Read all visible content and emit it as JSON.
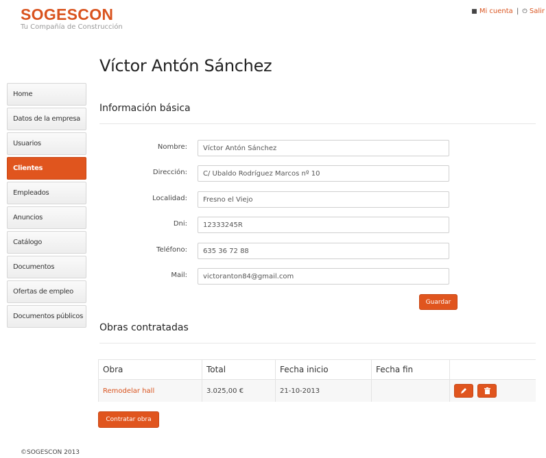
{
  "brand": {
    "name": "SOGESCON",
    "tagline": "Tu Compañía de Construcción"
  },
  "header": {
    "account_label": "Mi cuenta",
    "separator": "|",
    "logout_label": "Salir"
  },
  "sidebar": {
    "items": [
      {
        "label": "Home"
      },
      {
        "label": "Datos de la empresa"
      },
      {
        "label": "Usuarios"
      },
      {
        "label": "Clientes"
      },
      {
        "label": "Empleados"
      },
      {
        "label": "Anuncios"
      },
      {
        "label": "Catálogo"
      },
      {
        "label": "Documentos"
      },
      {
        "label": "Ofertas de empleo"
      },
      {
        "label": "Documentos públicos"
      }
    ],
    "active": "Clientes"
  },
  "page": {
    "title": "Víctor Antón Sánchez"
  },
  "basic_info": {
    "title": "Información básica",
    "fields": {
      "nombre": {
        "label": "Nombre:",
        "value": "Víctor Antón Sánchez"
      },
      "direccion": {
        "label": "Dirección:",
        "value": "C/ Ubaldo Rodríguez Marcos nº 10"
      },
      "localidad": {
        "label": "Localidad:",
        "value": "Fresno el Viejo"
      },
      "dni": {
        "label": "Dni:",
        "value": "12333245R"
      },
      "telefono": {
        "label": "Teléfono:",
        "value": "635 36 72 88"
      },
      "mail": {
        "label": "Mail:",
        "value": "victoranton84@gmail.com"
      }
    },
    "save_label": "Guardar"
  },
  "works": {
    "title": "Obras contratadas",
    "columns": [
      "Obra",
      "Total",
      "Fecha inicio",
      "Fecha fin"
    ],
    "rows": [
      {
        "obra": "Remodelar hall",
        "total": "3.025,00 €",
        "fecha_inicio": "21-10-2013",
        "fecha_fin": ""
      }
    ],
    "contract_label": "Contratar obra"
  },
  "footer": {
    "text": "©SOGESCON 2013"
  },
  "colors": {
    "accent": "#e0551e",
    "brand": "#d9531e"
  },
  "icons": {
    "account": "user-icon",
    "logout": "power-icon",
    "edit": "pencil-icon",
    "delete": "trash-icon"
  }
}
